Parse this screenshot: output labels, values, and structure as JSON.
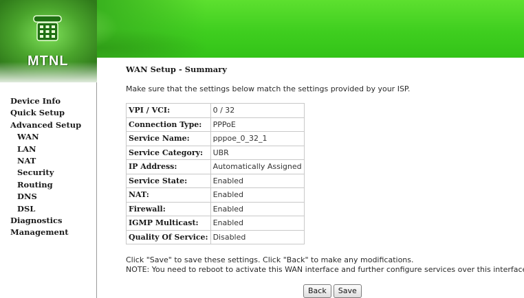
{
  "brand": {
    "name": "MTNL",
    "accent_color": "#3fce1f"
  },
  "sidebar": {
    "items": [
      {
        "label": "Device Info",
        "sub": false
      },
      {
        "label": "Quick Setup",
        "sub": false
      },
      {
        "label": "Advanced Setup",
        "sub": false
      },
      {
        "label": "WAN",
        "sub": true
      },
      {
        "label": "LAN",
        "sub": true
      },
      {
        "label": "NAT",
        "sub": true
      },
      {
        "label": "Security",
        "sub": true
      },
      {
        "label": "Routing",
        "sub": true
      },
      {
        "label": "DNS",
        "sub": true
      },
      {
        "label": "DSL",
        "sub": true
      },
      {
        "label": "Diagnostics",
        "sub": false
      },
      {
        "label": "Management",
        "sub": false
      }
    ]
  },
  "main": {
    "title": "WAN Setup - Summary",
    "intro": "Make sure that the settings below match the settings provided by your ISP.",
    "summary": [
      {
        "key": "VPI / VCI:",
        "value": "0 / 32"
      },
      {
        "key": "Connection Type:",
        "value": "PPPoE"
      },
      {
        "key": "Service Name:",
        "value": "pppoe_0_32_1"
      },
      {
        "key": "Service Category:",
        "value": "UBR"
      },
      {
        "key": "IP Address:",
        "value": "Automatically Assigned"
      },
      {
        "key": "Service State:",
        "value": "Enabled"
      },
      {
        "key": "NAT:",
        "value": "Enabled"
      },
      {
        "key": "Firewall:",
        "value": "Enabled"
      },
      {
        "key": "IGMP Multicast:",
        "value": "Enabled"
      },
      {
        "key": "Quality Of Service:",
        "value": "Disabled"
      }
    ],
    "footer_line1": "Click \"Save\" to save these settings. Click \"Back\" to make any modifications.",
    "footer_line2": "NOTE: You need to reboot to activate this WAN interface and further configure services over this interface.",
    "back_label": "Back",
    "save_label": "Save"
  }
}
